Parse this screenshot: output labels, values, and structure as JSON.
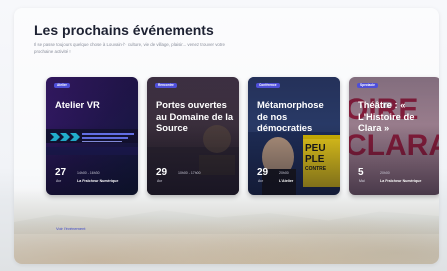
{
  "page": {
    "title": "Les prochains événements",
    "intro": "Il se passe toujours quelque chose à Louvain·l'· culture, vie de village, plaisir... venez trouver votre prochaine activité !",
    "see_all": "Voir l'événement"
  },
  "colors": {
    "accent": "#4e4fd8",
    "title": "#1e2233"
  },
  "cards": [
    {
      "tag": "Atelier",
      "title": "Atelier VR",
      "day": "27",
      "month": "Avr",
      "time": "14h00 - 16h30",
      "place": "La Fraîcheur Numérique"
    },
    {
      "tag": "Rencontre",
      "title": "Portes ouvertes au Domaine de la Source",
      "day": "29",
      "month": "Avr",
      "time": "10h00 - 17h00",
      "place": ""
    },
    {
      "tag": "Conférence",
      "title": "Métamorphose de nos démocraties",
      "day": "29",
      "month": "Avr",
      "time": "20h00",
      "place": "L'Atelier",
      "poster_text": "PEUPLE CONTRE"
    },
    {
      "tag": "Spectacle",
      "title": "Théâtre : « L'Histoire de Clara »",
      "day": "5",
      "month": "Mai",
      "time": "20h00",
      "place": "La Fraîcheur Numérique",
      "poster_text": "CLARA"
    }
  ]
}
